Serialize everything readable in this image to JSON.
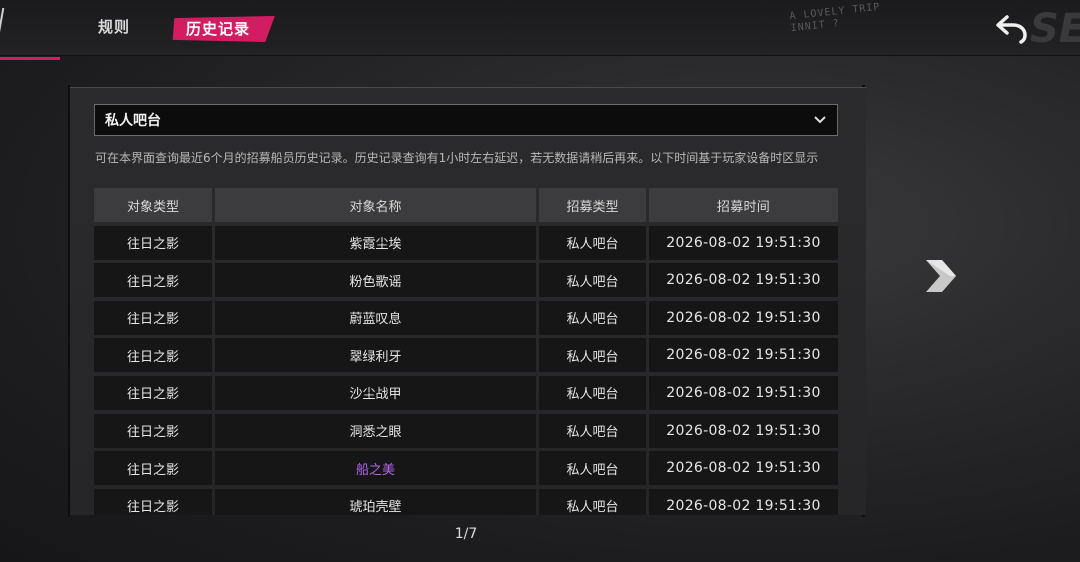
{
  "header": {
    "tabs": [
      {
        "label": "规则"
      },
      {
        "label": "历史记录"
      }
    ],
    "watermark": "A LOVELY TRIP INNIT ?"
  },
  "filter": {
    "selected": "私人吧台"
  },
  "notice": "可在本界面查询最近6个月的招募船员历史记录。历史记录查询有1小时左右延迟，若无数据请稍后再来。以下时间基于玩家设备时区显示",
  "table": {
    "columns": [
      "对象类型",
      "对象名称",
      "招募类型",
      "招募时间"
    ],
    "rows": [
      {
        "type": "往日之影",
        "name": "紫霞尘埃",
        "recruit": "私人吧台",
        "time": "2026-08-02 19:51:30"
      },
      {
        "type": "往日之影",
        "name": "粉色歌谣",
        "recruit": "私人吧台",
        "time": "2026-08-02 19:51:30"
      },
      {
        "type": "往日之影",
        "name": "蔚蓝叹息",
        "recruit": "私人吧台",
        "time": "2026-08-02 19:51:30"
      },
      {
        "type": "往日之影",
        "name": "翠绿利牙",
        "recruit": "私人吧台",
        "time": "2026-08-02 19:51:30"
      },
      {
        "type": "往日之影",
        "name": "沙尘战甲",
        "recruit": "私人吧台",
        "time": "2026-08-02 19:51:30"
      },
      {
        "type": "往日之影",
        "name": "洞悉之眼",
        "recruit": "私人吧台",
        "time": "2026-08-02 19:51:30"
      },
      {
        "type": "往日之影",
        "name": "船之美",
        "recruit": "私人吧台",
        "time": "2026-08-02 19:51:30"
      },
      {
        "type": "往日之影",
        "name": "琥珀壳壁",
        "recruit": "私人吧台",
        "time": "2026-08-02 19:51:30"
      }
    ]
  },
  "pagination": {
    "label": "1/7"
  },
  "colors": {
    "accent": "#d31d63",
    "highlight_name": "#b266e8"
  },
  "icons": {
    "back": "back-arrow-icon",
    "dropdown": "chevron-down-icon",
    "next": "chevron-right-icon"
  }
}
